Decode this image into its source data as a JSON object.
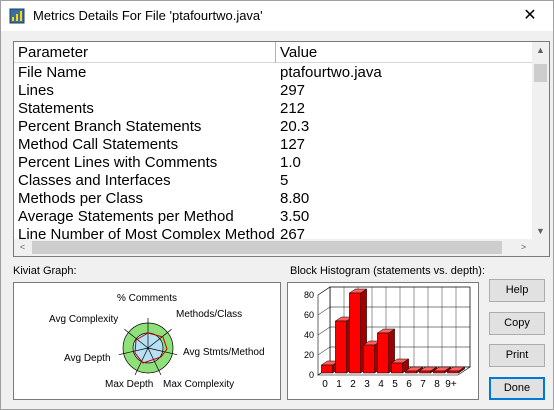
{
  "window": {
    "title": "Metrics Details For File 'ptafourtwo.java'",
    "close_glyph": "✕"
  },
  "table": {
    "headers": {
      "parameter": "Parameter",
      "value": "Value"
    },
    "rows": [
      {
        "parameter": "File Name",
        "value": "ptafourtwo.java"
      },
      {
        "parameter": "Lines",
        "value": "297"
      },
      {
        "parameter": "Statements",
        "value": "212"
      },
      {
        "parameter": "Percent Branch Statements",
        "value": "20.3"
      },
      {
        "parameter": "Method Call Statements",
        "value": "127"
      },
      {
        "parameter": "Percent Lines with Comments",
        "value": "1.0"
      },
      {
        "parameter": "Classes and Interfaces",
        "value": "5"
      },
      {
        "parameter": "Methods per Class",
        "value": "8.80"
      },
      {
        "parameter": "Average Statements per Method",
        "value": "3.50"
      },
      {
        "parameter": "Line Number of Most Complex Method",
        "value": "267"
      }
    ],
    "scroll": {
      "up": "▲",
      "down": "▼",
      "left": "<",
      "right": ">"
    }
  },
  "kiviat": {
    "label": "Kiviat Graph:",
    "axes": [
      "% Comments",
      "Methods/Class",
      "Avg Stmts/Method",
      "Max Complexity",
      "Max Depth",
      "Avg Depth",
      "Avg Complexity"
    ]
  },
  "histogram": {
    "label": "Block Histogram (statements vs. depth):"
  },
  "buttons": {
    "help": "Help",
    "copy": "Copy",
    "print": "Print",
    "done": "Done"
  },
  "chart_data": {
    "type": "bar",
    "categories": [
      "0",
      "1",
      "2",
      "3",
      "4",
      "5",
      "6",
      "7",
      "8",
      "9+"
    ],
    "values": [
      8,
      52,
      83,
      28,
      40,
      10,
      2,
      2,
      2,
      2
    ],
    "ylim": [
      0,
      80
    ],
    "yticks": [
      "0",
      "20",
      "40",
      "60",
      "80"
    ],
    "bar_color": "#ff0000"
  }
}
